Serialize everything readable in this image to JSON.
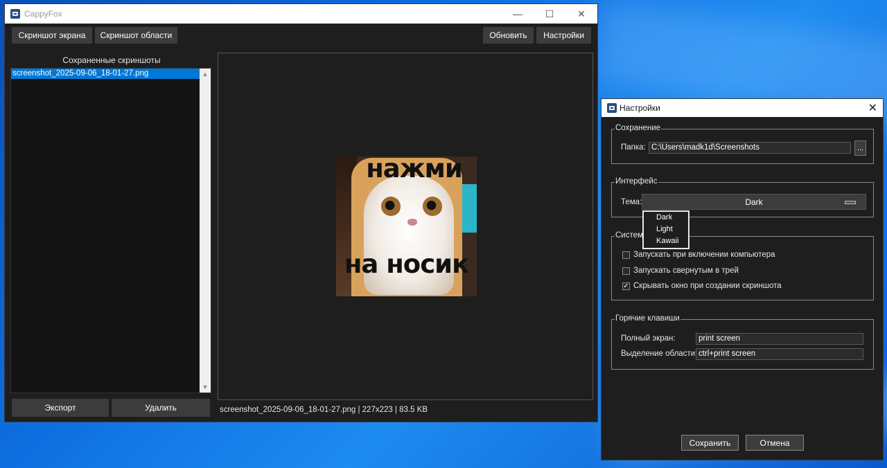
{
  "main_window": {
    "title": "CappyFox",
    "toolbar": {
      "screenshot_screen": "Скриншот экрана",
      "screenshot_area": "Скриншот области",
      "refresh": "Обновить",
      "settings": "Настройки"
    },
    "saved_label": "Сохраненные скриншоты",
    "files": [
      {
        "name": "screenshot_2025-09-06_18-01-27.png",
        "selected": true
      }
    ],
    "export_button": "Экспорт",
    "delete_button": "Удалить",
    "status": "screenshot_2025-09-06_18-01-27.png | 227x223 | 83.5 KB",
    "preview_text_top": "нажми",
    "preview_text_bottom": "на носик"
  },
  "settings_dialog": {
    "title": "Настройки",
    "saving": {
      "legend": "Сохранение",
      "folder_label": "Папка:",
      "folder_value": "C:\\Users\\madk1d\\Screenshots",
      "browse_label": "..."
    },
    "interface": {
      "legend": "Интерфейс",
      "theme_label": "Тема:",
      "theme_value": "Dark",
      "theme_options": [
        "Dark",
        "Light",
        "Kawaii"
      ]
    },
    "system": {
      "legend": "Систем",
      "options": [
        {
          "label": "Запускать при включении компьютера",
          "checked": false
        },
        {
          "label": "Запускать свернутым в трей",
          "checked": false
        },
        {
          "label": "Скрывать окно при создании скриншота",
          "checked": true
        }
      ]
    },
    "hotkeys": {
      "legend": "Горячие клавиши",
      "fullscreen_label": "Полный экран:",
      "fullscreen_value": "print screen",
      "area_label": "Выделение области:",
      "area_value": "ctrl+print screen"
    },
    "save_button": "Сохранить",
    "cancel_button": "Отмена"
  },
  "colors": {
    "selection": "#0078d7",
    "window_bg": "#1e1e1e",
    "button_bg": "#3c3c3c"
  }
}
